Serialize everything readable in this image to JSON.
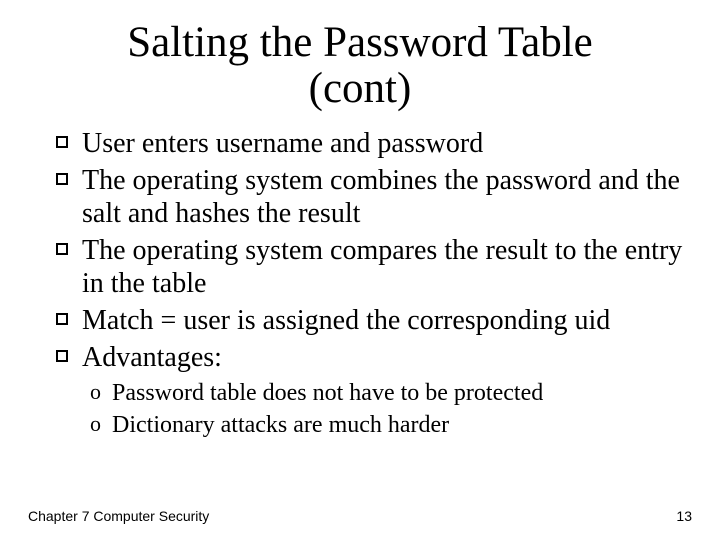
{
  "title_line1": "Salting the Password Table",
  "title_line2": "(cont)",
  "bullets": [
    "User enters username and password",
    "The operating system combines the password and the salt and hashes the result",
    "The operating system compares the result to the entry in the table",
    "Match = user is assigned the corresponding uid",
    "Advantages:"
  ],
  "sub_bullets": [
    "Password table does not have to be protected",
    "Dictionary attacks are much harder"
  ],
  "footer_left": "Chapter 7   Computer Security",
  "footer_right": "13"
}
